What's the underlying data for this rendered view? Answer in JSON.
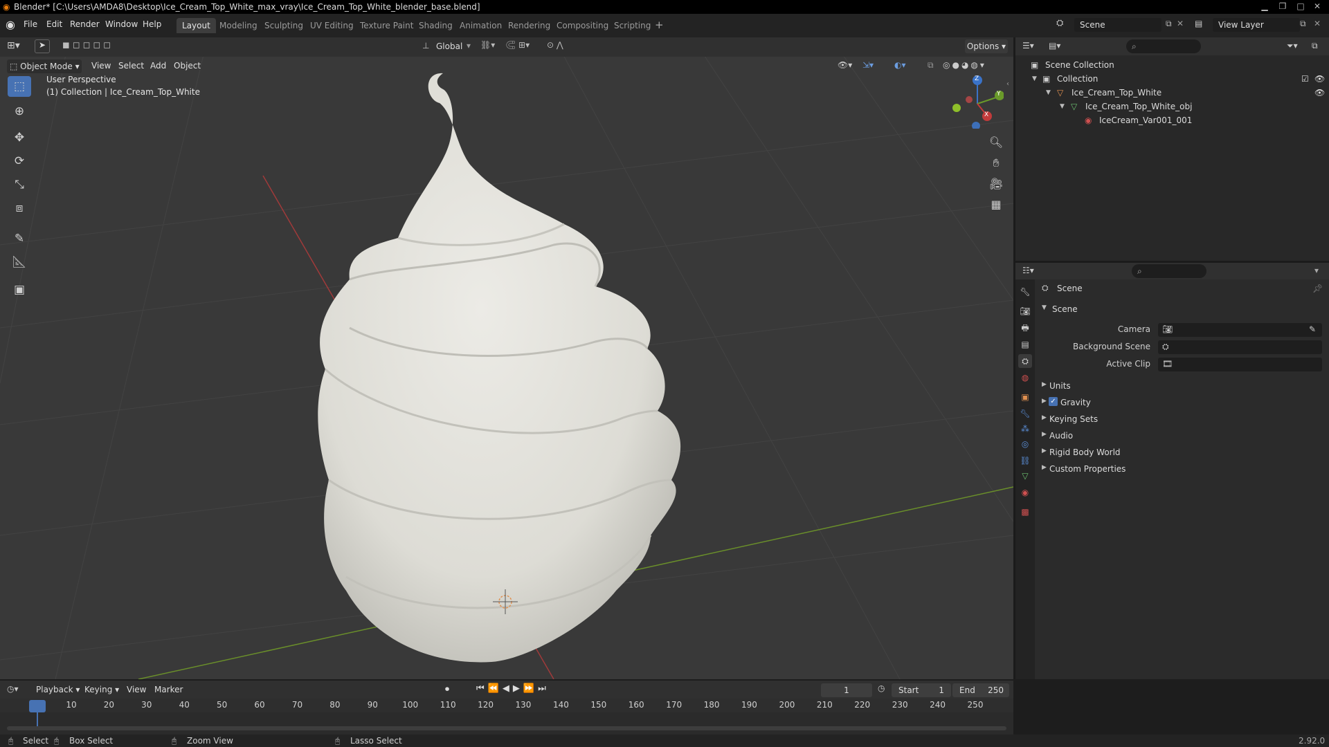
{
  "window": {
    "title": "Blender* [C:\\Users\\AMDA8\\Desktop\\Ice_Cream_Top_White_max_vray\\Ice_Cream_Top_White_blender_base.blend]"
  },
  "menu": [
    "File",
    "Edit",
    "Render",
    "Window",
    "Help"
  ],
  "workspaces": [
    "Layout",
    "Modeling",
    "Sculpting",
    "UV Editing",
    "Texture Paint",
    "Shading",
    "Animation",
    "Rendering",
    "Compositing",
    "Scripting"
  ],
  "active_workspace": "Layout",
  "scene_field": "Scene",
  "view_layer_field": "View Layer",
  "toolbar": {
    "transform_orientation": "Global",
    "options_label": "Options"
  },
  "viewport": {
    "mode": "Object Mode",
    "menus": [
      "View",
      "Select",
      "Add",
      "Object"
    ],
    "overlay_line1": "User Perspective",
    "overlay_line2": "(1) Collection | Ice_Cream_Top_White",
    "gizmo": {
      "z": "Z",
      "y": "Y",
      "x": "X"
    }
  },
  "outliner": {
    "rows": [
      {
        "label": "Scene Collection"
      },
      {
        "label": "Collection"
      },
      {
        "label": "Ice_Cream_Top_White"
      },
      {
        "label": "Ice_Cream_Top_White_obj"
      },
      {
        "label": "IceCream_Var001_001"
      }
    ]
  },
  "properties": {
    "context": "Scene",
    "panel_title": "Scene",
    "fields": [
      {
        "label": "Camera"
      },
      {
        "label": "Background Scene"
      },
      {
        "label": "Active Clip"
      }
    ],
    "sections": [
      "Units",
      "Gravity",
      "Keying Sets",
      "Audio",
      "Rigid Body World",
      "Custom Properties"
    ],
    "gravity_checked": true
  },
  "timeline": {
    "menus": [
      "Playback",
      "Keying",
      "View",
      "Marker"
    ],
    "current_frame": "1",
    "start_label": "Start",
    "start_value": "1",
    "end_label": "End",
    "end_value": "250",
    "ticks": [
      "1",
      "10",
      "20",
      "30",
      "40",
      "50",
      "60",
      "70",
      "80",
      "90",
      "100",
      "110",
      "120",
      "130",
      "140",
      "150",
      "160",
      "170",
      "180",
      "190",
      "200",
      "210",
      "220",
      "230",
      "240",
      "250"
    ]
  },
  "statusbar": {
    "select": "Select",
    "box_select": "Box Select",
    "zoom_view": "Zoom View",
    "lasso_select": "Lasso Select",
    "version": "2.92.0"
  },
  "colors": {
    "accent": "#4772b3",
    "axis_red": "#a03a3a",
    "axis_green": "#6a8f2a",
    "viewport_bg": "#393939"
  }
}
